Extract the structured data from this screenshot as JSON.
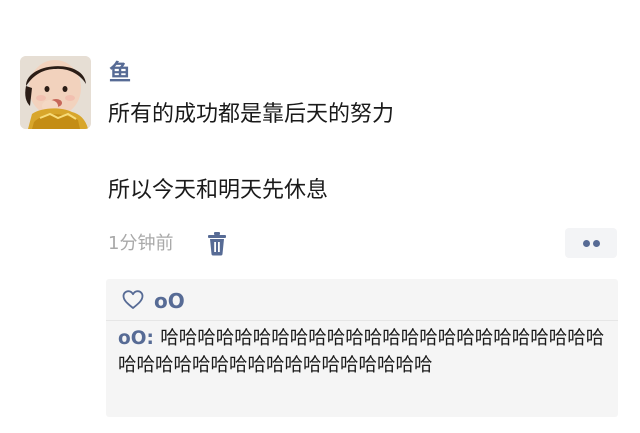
{
  "post": {
    "author": "鱼",
    "lines": [
      "所有的成功都是靠后天的努力",
      "所以今天和明天先休息"
    ],
    "time": "1分钟前"
  },
  "icons": {
    "avatar": "avatar-photo",
    "delete": "trash-icon",
    "more": "more-dots-icon",
    "like": "heart-icon"
  },
  "colors": {
    "link": "#576b95",
    "meta": "#a9a9a9",
    "comment_bg": "#f5f5f5"
  },
  "likes": {
    "users": "oO"
  },
  "comments": [
    {
      "author": "oO",
      "separator": ": ",
      "text": "哈哈哈哈哈哈哈哈哈哈哈哈哈哈哈哈哈哈哈哈哈哈哈哈哈哈哈哈哈哈哈哈哈哈哈哈哈哈哈哈哈"
    }
  ]
}
